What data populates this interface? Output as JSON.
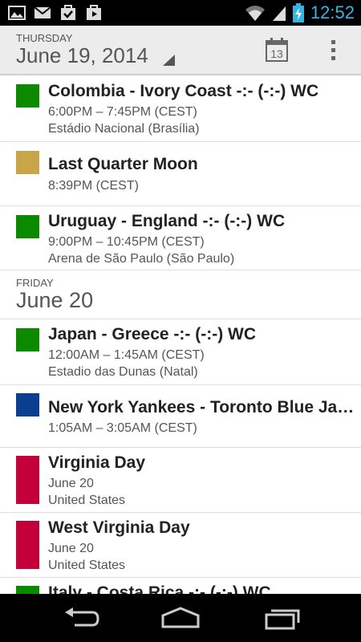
{
  "status_bar": {
    "time": "12:52",
    "icons": [
      "gallery-icon",
      "gmail-icon",
      "tasks-icon",
      "play-store-icon",
      "wifi-icon",
      "signal-icon",
      "battery-charging-icon"
    ]
  },
  "action_bar": {
    "day_name": "Thursday",
    "date": "June 19, 2014",
    "today_icon_number": "13"
  },
  "events_day1": [
    {
      "title": "Colombia - Ivory Coast -:- (-:-) WC",
      "time": "6:00PM – 7:45PM (CEST)",
      "location": "Estádio Nacional (Brasília)",
      "color": "#0b8a00"
    },
    {
      "title": "Last Quarter Moon",
      "time": "8:39PM (CEST)",
      "color": "#c9a54a"
    },
    {
      "title": "Uruguay - England -:- (-:-) WC",
      "time": "9:00PM – 10:45PM (CEST)",
      "location": "Arena de São Paulo (São Paulo)",
      "color": "#0b8a00"
    }
  ],
  "day_header": {
    "day_name": "Friday",
    "date": "June 20"
  },
  "events_day2": [
    {
      "title": "Japan - Greece -:- (-:-) WC",
      "time": "12:00AM – 1:45AM (CEST)",
      "location": "Estadio das Dunas (Natal)",
      "color": "#0b8a00"
    },
    {
      "title": "New York Yankees - Toronto Blue Ja…",
      "time": "1:05AM – 3:05AM (CEST)",
      "color": "#0a3f8f"
    },
    {
      "title": "Virginia Day",
      "time": "June 20",
      "location": "United States",
      "color": "#c4003a"
    },
    {
      "title": "West Virginia Day",
      "time": "June 20",
      "location": "United States",
      "color": "#c4003a"
    },
    {
      "title": "Italy - Costa Rica -:- (-:-) WC",
      "color": "#0b8a00"
    }
  ]
}
